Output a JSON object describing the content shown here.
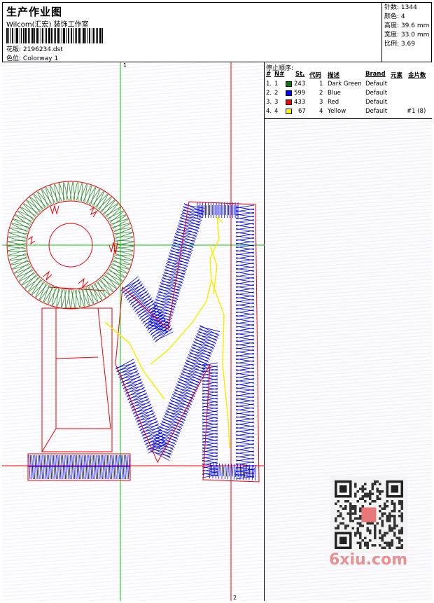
{
  "header": {
    "title": "生产作业图",
    "company": "Wilcom(汇宏) 装饰工作室",
    "design_label": "花版:",
    "design_value": "2196234.dst",
    "colorway_label": "色位:",
    "colorway_value": "Colorway 1"
  },
  "specs": [
    {
      "label": "针数:",
      "value": "1344"
    },
    {
      "label": "颜色:",
      "value": "4"
    },
    {
      "label": "高度:",
      "value": "39.6 mm"
    },
    {
      "label": "宽度:",
      "value": "33.0 mm"
    },
    {
      "label": "比例:",
      "value": "3.69"
    }
  ],
  "guides": {
    "marker_1": "1",
    "marker_2": "2"
  },
  "stop_sequence": {
    "title": "停止顺序:",
    "columns": [
      "#",
      "N#",
      "St.",
      "代码",
      "描述",
      "Brand",
      "元素",
      "金片数"
    ],
    "rows": [
      {
        "idx": "1.",
        "n": "1",
        "color": "#008000",
        "st": "243",
        "code": "1",
        "desc": "Dark Green",
        "brand": "Default",
        "extra": ""
      },
      {
        "idx": "2.",
        "n": "2",
        "color": "#0000ff",
        "st": "599",
        "code": "2",
        "desc": "Blue",
        "brand": "Default",
        "extra": ""
      },
      {
        "idx": "3.",
        "n": "3",
        "color": "#ff0000",
        "st": "433",
        "code": "3",
        "desc": "Red",
        "brand": "Default",
        "extra": ""
      },
      {
        "idx": "4.",
        "n": "4",
        "color": "#ffff00",
        "st": "67",
        "code": "4",
        "desc": "Yellow",
        "brand": "Default",
        "extra": "#1 (8)"
      }
    ]
  },
  "watermark": "6xiu.com",
  "colors": {
    "green": "#2e8b2e",
    "blue": "#0000ee",
    "red": "#ee0000",
    "yellow": "#f5f000",
    "guide_red": "#ff0000",
    "guide_green": "#00cc00"
  }
}
